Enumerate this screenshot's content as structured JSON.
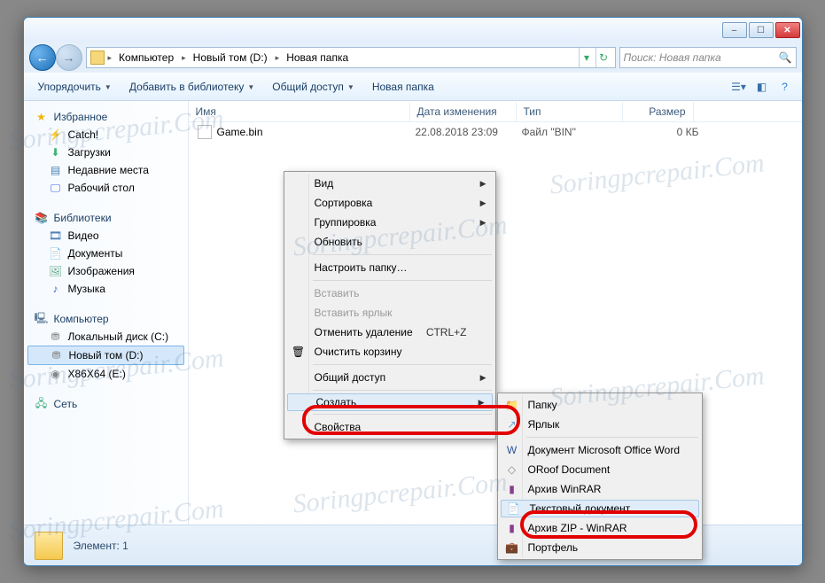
{
  "window": {
    "min_glyph": "–",
    "max_glyph": "☐",
    "close_glyph": "✕"
  },
  "nav": {
    "back_glyph": "←",
    "fwd_glyph": "→"
  },
  "breadcrumb": {
    "items": [
      "Компьютер",
      "Новый том (D:)",
      "Новая папка"
    ]
  },
  "search": {
    "placeholder": "Поиск: Новая папка",
    "icon": "🔍"
  },
  "toolbar": {
    "organize": "Упорядочить",
    "addlib": "Добавить в библиотеку",
    "share": "Общий доступ",
    "newfolder": "Новая папка"
  },
  "columns": {
    "name": "Имя",
    "date": "Дата изменения",
    "type": "Тип",
    "size": "Размер"
  },
  "files": [
    {
      "name": "Game.bin",
      "date": "22.08.2018 23:09",
      "type": "Файл \"BIN\"",
      "size": "0 КБ"
    }
  ],
  "sidebar": {
    "favorites": {
      "label": "Избранное",
      "items": [
        "Catch!",
        "Загрузки",
        "Недавние места",
        "Рабочий стол"
      ]
    },
    "libraries": {
      "label": "Библиотеки",
      "items": [
        "Видео",
        "Документы",
        "Изображения",
        "Музыка"
      ]
    },
    "computer": {
      "label": "Компьютер",
      "items": [
        "Локальный диск (C:)",
        "Новый том (D:)",
        "X86X64 (E:)"
      ]
    },
    "network": {
      "label": "Сеть"
    }
  },
  "status": {
    "text": "Элемент: 1"
  },
  "context_main": {
    "view": "Вид",
    "sort": "Сортировка",
    "group": "Группировка",
    "refresh": "Обновить",
    "customize": "Настроить папку…",
    "paste": "Вставить",
    "pasteShortcut": "Вставить ярлык",
    "undo": "Отменить удаление",
    "undo_key": "CTRL+Z",
    "emptybin": "Очистить корзину",
    "shareaccess": "Общий доступ",
    "create": "Создать",
    "properties": "Свойства"
  },
  "context_create": {
    "folder": "Папку",
    "shortcut": "Ярлык",
    "wordDoc": "Документ Microsoft Office Word",
    "oroof": "ORoof Document",
    "rar": "Архив WinRAR",
    "txt": "Текстовый документ",
    "zip": "Архив ZIP - WinRAR",
    "briefcase": "Портфель"
  },
  "watermark": "Soringpcrepair.Com"
}
